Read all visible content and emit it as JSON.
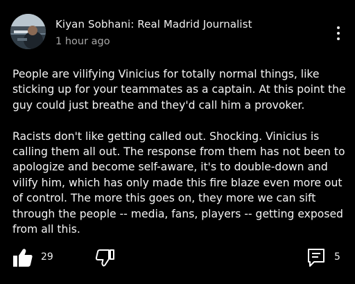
{
  "comment": {
    "author": "Kiyan Sobhani: Real Madrid Journalist",
    "timestamp": "1 hour ago",
    "paragraphs": [
      "People are vilifying Vinicius for totally normal things, like sticking up for your teammates as a captain. At this point the guy could just breathe and they'd call him a provoker.",
      "Racists don't like getting called out. Shocking. Vinicius is calling them all out. The response from them has not been to apologize and become self-aware, it's to double-down and vilify him, which has only made this fire blaze even more out of control. The more this goes on, they more we can sift through the people -- media, fans, players -- getting exposed from all this."
    ]
  },
  "actions": {
    "like_count": "29",
    "reply_count": "5"
  },
  "icons": {
    "avatar": "profile-photo",
    "more": "more-vertical-icon",
    "like": "thumbs-up-filled-icon",
    "dislike": "thumbs-down-outline-icon",
    "reply": "comment-reply-icon"
  },
  "colors": {
    "background": "#000000",
    "text": "#f5f5f5",
    "muted": "#a8a8a8"
  }
}
